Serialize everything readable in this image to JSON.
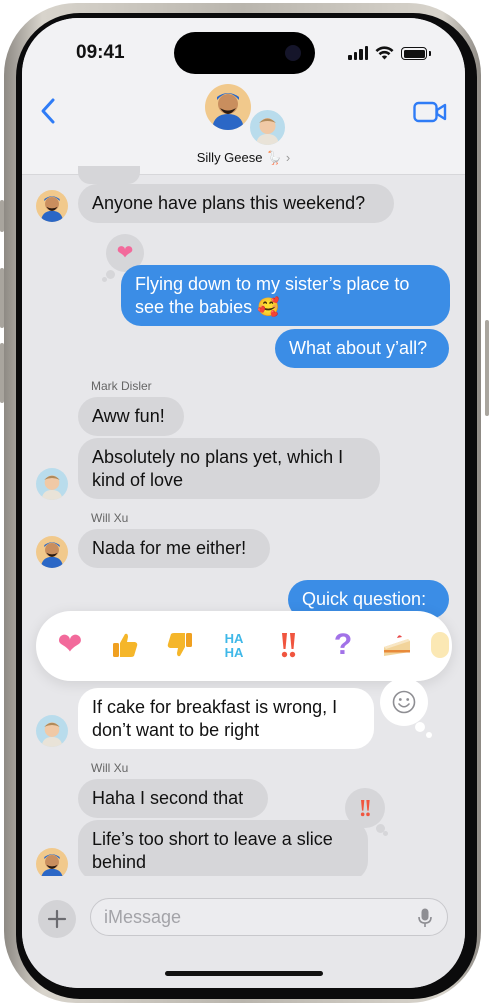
{
  "status": {
    "time": "09:41"
  },
  "header": {
    "group_name": "Silly Geese",
    "name_emoji": "🪿",
    "chevron": "›"
  },
  "messages": [
    {
      "text": "Anyone have plans this weekend?",
      "direction": "incoming"
    },
    {
      "text": "Flying down to my sister’s place to see the babies 🥰",
      "direction": "outgoing",
      "tapback": "heart"
    },
    {
      "text": "What about y’all?",
      "direction": "outgoing"
    },
    {
      "sender": "Mark Disler",
      "text": "Aww fun!",
      "direction": "incoming"
    },
    {
      "text": "Absolutely no plans yet, which I kind of love",
      "direction": "incoming"
    },
    {
      "sender": "Will Xu",
      "text": "Nada for me either!",
      "direction": "incoming"
    },
    {
      "text": "Quick question:",
      "direction": "outgoing"
    },
    {
      "text": "If cake for breakfast is wrong, I don’t want to be right",
      "direction": "incoming",
      "selected": true
    },
    {
      "sender": "Will Xu",
      "text": "Haha I second that",
      "direction": "incoming"
    },
    {
      "text": "Life’s too short to leave a slice behind",
      "direction": "incoming",
      "tapback": "exclamation"
    }
  ],
  "reaction_bar": [
    {
      "name": "heart",
      "glyph": "❤"
    },
    {
      "name": "thumbs-up",
      "glyph": "👍"
    },
    {
      "name": "thumbs-down",
      "glyph": "👎"
    },
    {
      "name": "haha",
      "glyph": "HA HA"
    },
    {
      "name": "exclamation",
      "glyph": "‼"
    },
    {
      "name": "question",
      "glyph": "?"
    },
    {
      "name": "cake",
      "glyph": "🍰"
    },
    {
      "name": "emoji-picker",
      "glyph": "☺"
    }
  ],
  "compose": {
    "placeholder": "iMessage",
    "add_icon": "plus-icon",
    "mic_icon": "mic-icon"
  },
  "colors": {
    "outgoing": "#3b8de6",
    "incoming": "#d6d6d9",
    "accent": "#2f7cf6",
    "heart": "#f26a9b"
  }
}
